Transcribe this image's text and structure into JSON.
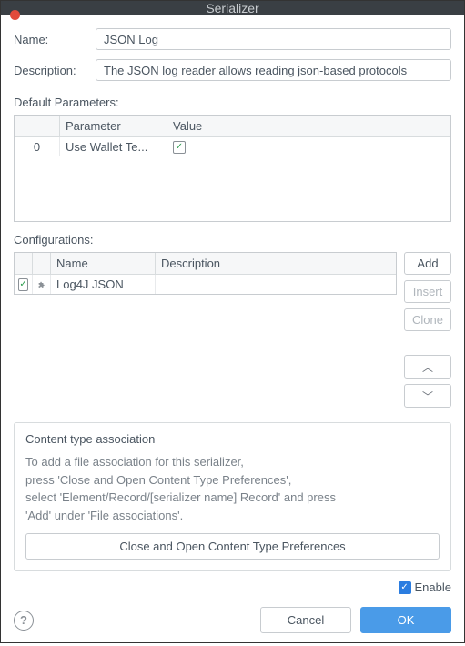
{
  "window": {
    "title": "Serializer"
  },
  "form": {
    "name_label": "Name:",
    "name_value": "JSON Log",
    "desc_label": "Description:",
    "desc_value": "The JSON log reader allows reading json-based protocols"
  },
  "params_section": {
    "title": "Default Parameters:",
    "headers": {
      "idx": "",
      "param": "Parameter",
      "value": "Value"
    },
    "rows": [
      {
        "idx": "0",
        "param": "Use Wallet Te...",
        "checked": true
      }
    ]
  },
  "configs_section": {
    "title": "Configurations:",
    "headers": {
      "chk": "",
      "icon": "",
      "name": "Name",
      "desc": "Description"
    },
    "rows": [
      {
        "checked": true,
        "name": "Log4J JSON",
        "desc": ""
      }
    ],
    "buttons": {
      "add": "Add",
      "insert": "Insert",
      "clone": "Clone"
    }
  },
  "assoc": {
    "group_title": "Content type association",
    "line1": "To add a file association for this serializer,",
    "line2": "press 'Close and Open Content Type Preferences',",
    "line3": "select 'Element/Record/[serializer name] Record' and press",
    "line4": "'Add' under 'File associations'.",
    "button": "Close and Open Content Type Preferences"
  },
  "enable": {
    "label": "Enable",
    "checked": true
  },
  "footer": {
    "cancel": "Cancel",
    "ok": "OK"
  }
}
